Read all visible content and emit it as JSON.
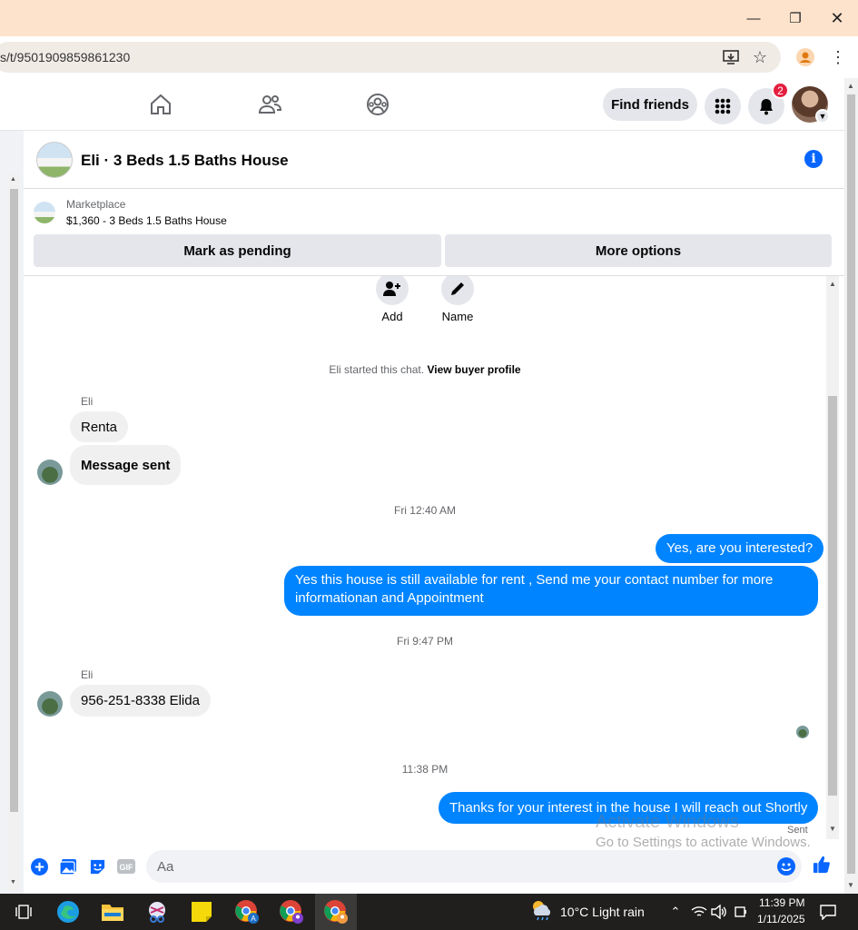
{
  "browser": {
    "url": "s/t/9501909859861230"
  },
  "nav": {
    "find_friends": "Find friends",
    "notification_count": "2"
  },
  "chat": {
    "title": "Eli · 3 Beds 1.5 Baths House",
    "marketplace_label": "Marketplace",
    "listing": "$1,360 - 3 Beds 1.5 Baths House",
    "mark_pending": "Mark as pending",
    "more_options": "More options",
    "add_label": "Add",
    "name_label": "Name",
    "started_text": "Eli started this chat.",
    "view_profile": "View buyer profile",
    "messages": [
      {
        "sender": "Eli",
        "text": "Renta"
      },
      {
        "text": "Message sent"
      },
      {
        "time": "Fri 12:40 AM"
      },
      {
        "text": "Yes, are you interested?"
      },
      {
        "text": "Yes this house is still available for rent , Send me your contact number for more informationan and Appointment"
      },
      {
        "time": "Fri 9:47 PM"
      },
      {
        "sender": "Eli",
        "text": "956-251-8338 Elida"
      },
      {
        "time": "11:38 PM"
      },
      {
        "text": "Thanks for your interest in the house I will reach out Shortly"
      }
    ],
    "sent_status": "Sent",
    "composer_placeholder": "Aa"
  },
  "watermark": {
    "line1": "Activate Windows",
    "line2": "Go to Settings to activate Windows."
  },
  "taskbar": {
    "weather": "10°C  Light rain",
    "time": "11:39 PM",
    "date": "1/11/2025"
  },
  "colors": {
    "accent": "#0084ff",
    "fb_blue": "#0866ff",
    "badge": "#e41e3f"
  }
}
